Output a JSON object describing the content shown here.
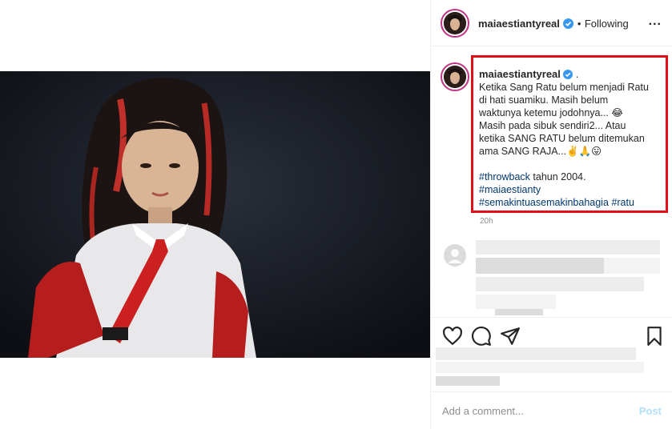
{
  "post": {
    "username": "maiaestiantyreal",
    "separator": "•",
    "follow_status": "Following",
    "more_label": "...",
    "caption": {
      "username": "maiaestiantyreal",
      "after_badge": ".",
      "line1": "Ketika Sang Ratu belum menjadi Ratu",
      "line2": "di hati suamiku. Masih belum",
      "line3": "waktunya ketemu jodohnya... 😂",
      "line4": "Masih pada sibuk sendiri2... Atau",
      "line5": "ketika SANG RATU belum ditemukan",
      "line6": "ama SANG RAJA...✌️🙏😛",
      "tag_throwback": "#throwback",
      "tahun": " tahun 2004.",
      "tag_maia": "#maiaestianty",
      "tag_semakin": "#semakintuasemakinbahagia",
      "tag_ratu": "#ratu"
    },
    "timestamp": "20h",
    "comment_placeholder": "Add a comment...",
    "post_label": "Post"
  },
  "colors": {
    "verified": "#3897f0",
    "highlight_box": "#e0101b",
    "hashtag": "#00376b"
  },
  "icons": [
    "verified-badge-icon",
    "more-options-icon",
    "heart-icon",
    "comment-icon",
    "share-icon",
    "bookmark-icon",
    "default-avatar-icon"
  ]
}
